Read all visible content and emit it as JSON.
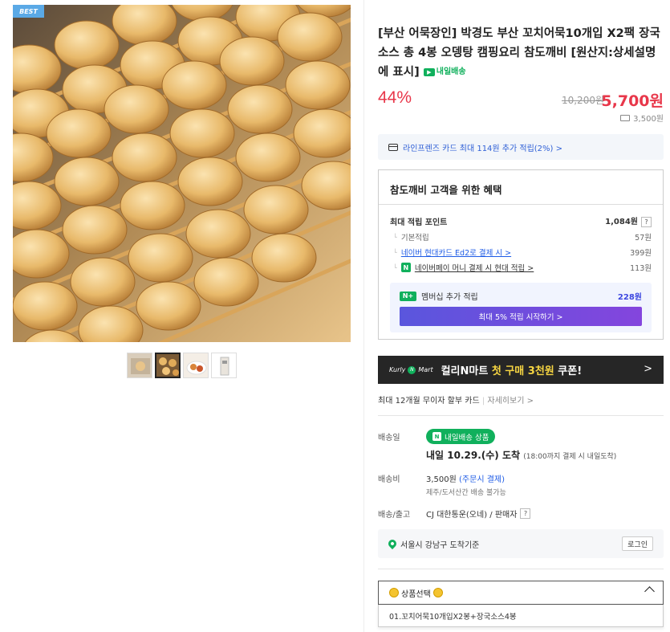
{
  "gallery": {
    "badge": "BEST",
    "thumb_count": 4
  },
  "product": {
    "title": "[부산 어묵장인] 박경도 부산 꼬치어묵10개입 X2팩 장국소스 총 4봉 오뎅탕 캠핑요리 참도깨비 [원산지:상세설명에 표시]",
    "tomorrow_delivery_chip": "내일배송",
    "discount": "44%",
    "original_price": "10,200원",
    "sale_price": "5,700원",
    "delivery_fee": "3,500원"
  },
  "card_banner": {
    "text": "라인프렌즈 카드 최대 114원 추가 적립(2%) >"
  },
  "benefits": {
    "title": "참도깨비 고객을 위한 혜택",
    "max_points_label": "최대 적립 포인트",
    "max_points_value": "1,084원",
    "help": "?",
    "rows": [
      {
        "label": "기본적립",
        "value": "57원"
      },
      {
        "label": "네이버 현대카드 Ed2로 결제 시 >",
        "value": "399원"
      },
      {
        "label": "네이버페이 머니 결제 시 현대 적립 >",
        "value": "113원"
      }
    ],
    "npay_icon": "N",
    "member": {
      "icon": "N+",
      "label": "멤버십 추가 적립",
      "value": "228원"
    },
    "start_button": "최대 5% 적립 시작하기 >"
  },
  "kurly": {
    "logo": "Kurly",
    "logo_mid": "N",
    "logo_end": "Mart",
    "text_prefix": "컬리N마트 ",
    "text_highlight": "첫 구매 3천원",
    "text_suffix": " 쿠폰!",
    "chevron": ">"
  },
  "installment": {
    "text": "최대 12개월 무이자 할부 카드",
    "more": "자세히보기 >"
  },
  "shipping": {
    "date_label": "배송일",
    "badge_icon": "N",
    "badge": "내일배송 상품",
    "arrive": "내일 10.29.(수) 도착",
    "arrive_note": "(18:00까지 결제 시 내일도착)",
    "fee_label": "배송비",
    "fee": "3,500원",
    "fee_pay": "(주문시 결제)",
    "fee_note": "제주/도서산간 배송 불가능",
    "carrier_label": "배송/출고",
    "carrier": "CJ 대한통운(오네) / 판매자",
    "carrier_help": "?"
  },
  "location": {
    "text": "서울시 강남구 도착기준",
    "login": "로그인"
  },
  "select": {
    "label": "상품선택",
    "emoji_left": "😊",
    "emoji_right": "😊",
    "option": "01.꼬치어묵10개입X2봉+장국소스4봉"
  }
}
